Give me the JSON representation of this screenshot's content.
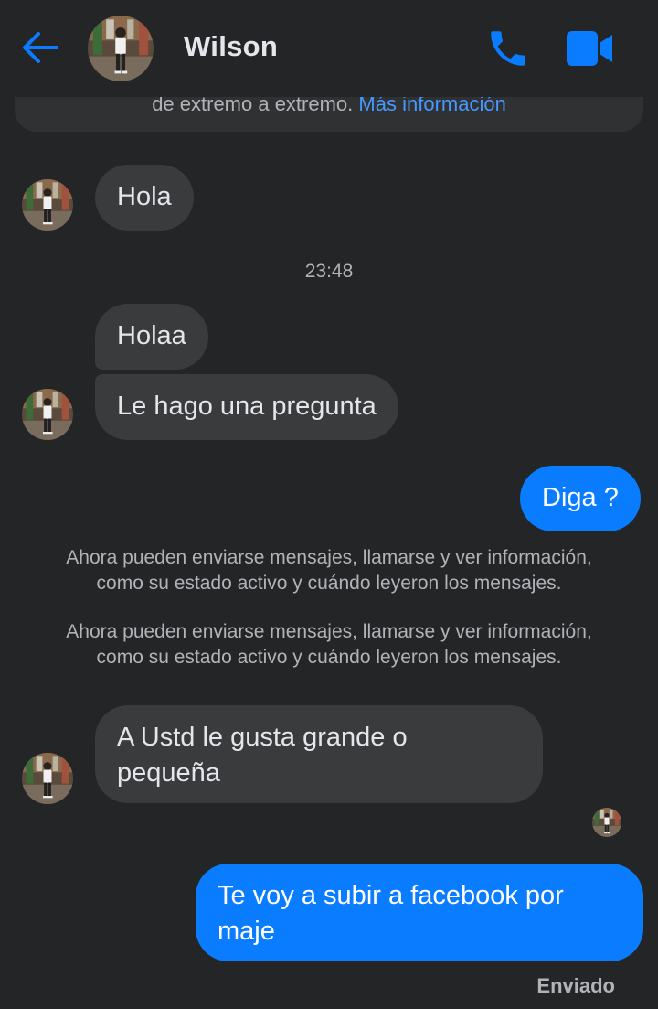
{
  "header": {
    "contact_name": "Wilson",
    "back_icon": "arrow-left-icon",
    "call_icon": "phone-icon",
    "video_icon": "video-camera-icon",
    "accent_color": "#0a7cff"
  },
  "encryption_notice": {
    "text": "de extremo a extremo.",
    "link": "Más información"
  },
  "messages": [
    {
      "direction": "in",
      "text": "Hola"
    },
    {
      "direction": "timestamp",
      "text": "23:48"
    },
    {
      "direction": "in",
      "text": "Holaa"
    },
    {
      "direction": "in",
      "text": "Le hago una pregunta"
    },
    {
      "direction": "out",
      "text": "Diga ?"
    },
    {
      "direction": "system",
      "line1": "Ahora pueden enviarse mensajes, llamarse y ver información,",
      "line2": "como su estado activo y cuándo leyeron los mensajes."
    },
    {
      "direction": "system",
      "line1": "Ahora pueden enviarse mensajes, llamarse y ver información,",
      "line2": "como su estado activo y cuándo leyeron los mensajes."
    },
    {
      "direction": "in",
      "line1": "A Ustd le gusta grande o",
      "line2": "pequeña"
    },
    {
      "direction": "out",
      "line1": "Te voy a subir a facebook por",
      "line2": "maje"
    }
  ],
  "status": {
    "sent_label": "Enviado"
  },
  "colors": {
    "background": "#242526",
    "incoming_bubble": "#3a3b3c",
    "outgoing_bubble": "#0a7cff",
    "secondary_text": "#b0b3b8"
  }
}
